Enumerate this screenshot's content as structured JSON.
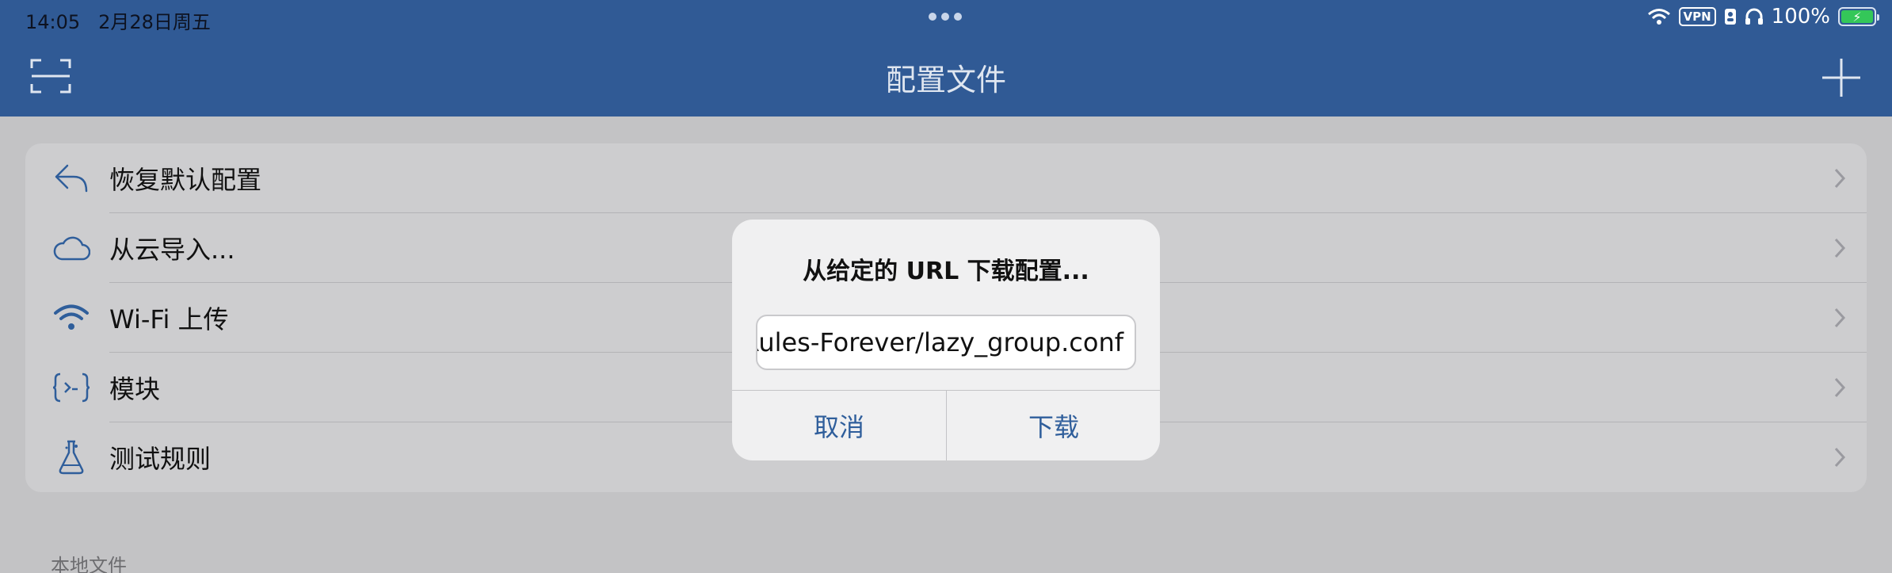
{
  "status": {
    "time": "14:05",
    "date": "2月28日周五",
    "vpn": "VPN",
    "battery": "100%"
  },
  "nav": {
    "title": "配置文件"
  },
  "menu": [
    {
      "label": "恢复默认配置",
      "icon": "undo-arrow-icon"
    },
    {
      "label": "从云导入...",
      "icon": "cloud-icon"
    },
    {
      "label": "Wi-Fi 上传",
      "icon": "wifi-icon"
    },
    {
      "label": "模块",
      "icon": "module-braces-icon"
    },
    {
      "label": "测试规则",
      "icon": "flask-icon"
    }
  ],
  "section": {
    "local_files": "本地文件"
  },
  "dialog": {
    "title": "从给定的 URL 下载配置...",
    "url_value": "Rules-Forever/lazy_group.conf",
    "cancel_label": "取消",
    "download_label": "下载"
  },
  "colors": {
    "nav_bar": "#305a95",
    "accent": "#2f5e9b",
    "battery": "#34c759"
  }
}
